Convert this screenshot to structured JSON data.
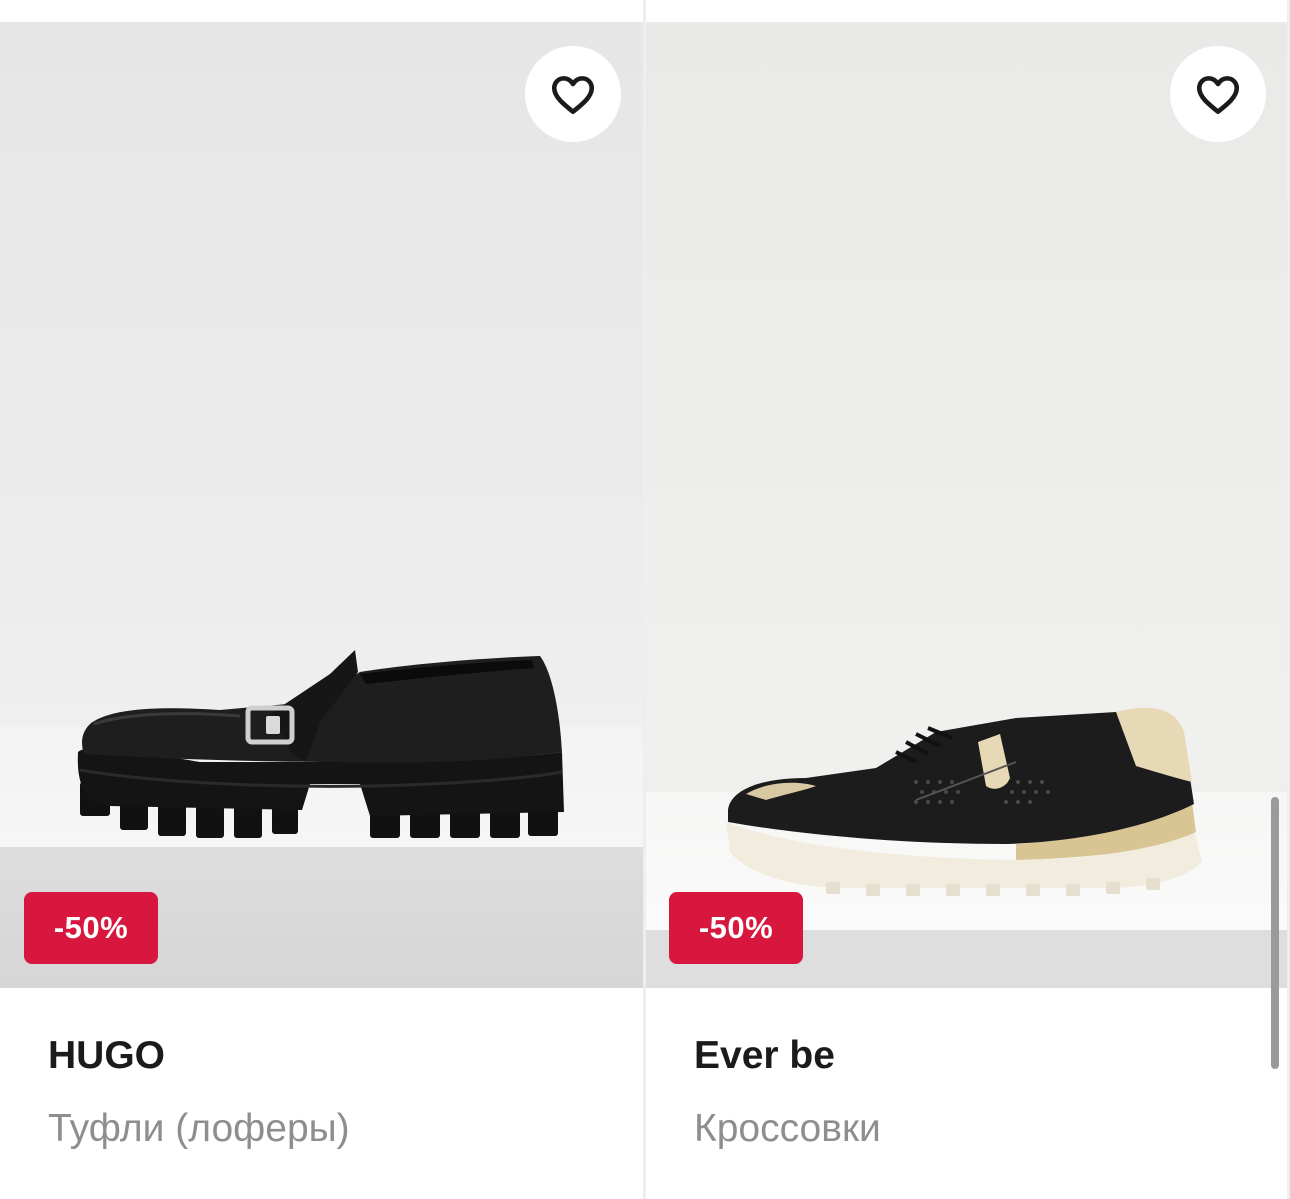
{
  "products": [
    {
      "brand": "HUGO",
      "category": "Туфли (лоферы)",
      "discount": "-50%",
      "shoe": "black-platform-loafer",
      "favorite_icon": "heart-outline-icon"
    },
    {
      "brand": "Ever be",
      "category": "Кроссовки",
      "discount": "-50%",
      "shoe": "black-perforated-sneaker",
      "favorite_icon": "heart-outline-icon"
    }
  ],
  "colors": {
    "discount_badge": "#d8173f",
    "brand_text": "#1b1b1b",
    "category_text": "#8e8e8e"
  }
}
